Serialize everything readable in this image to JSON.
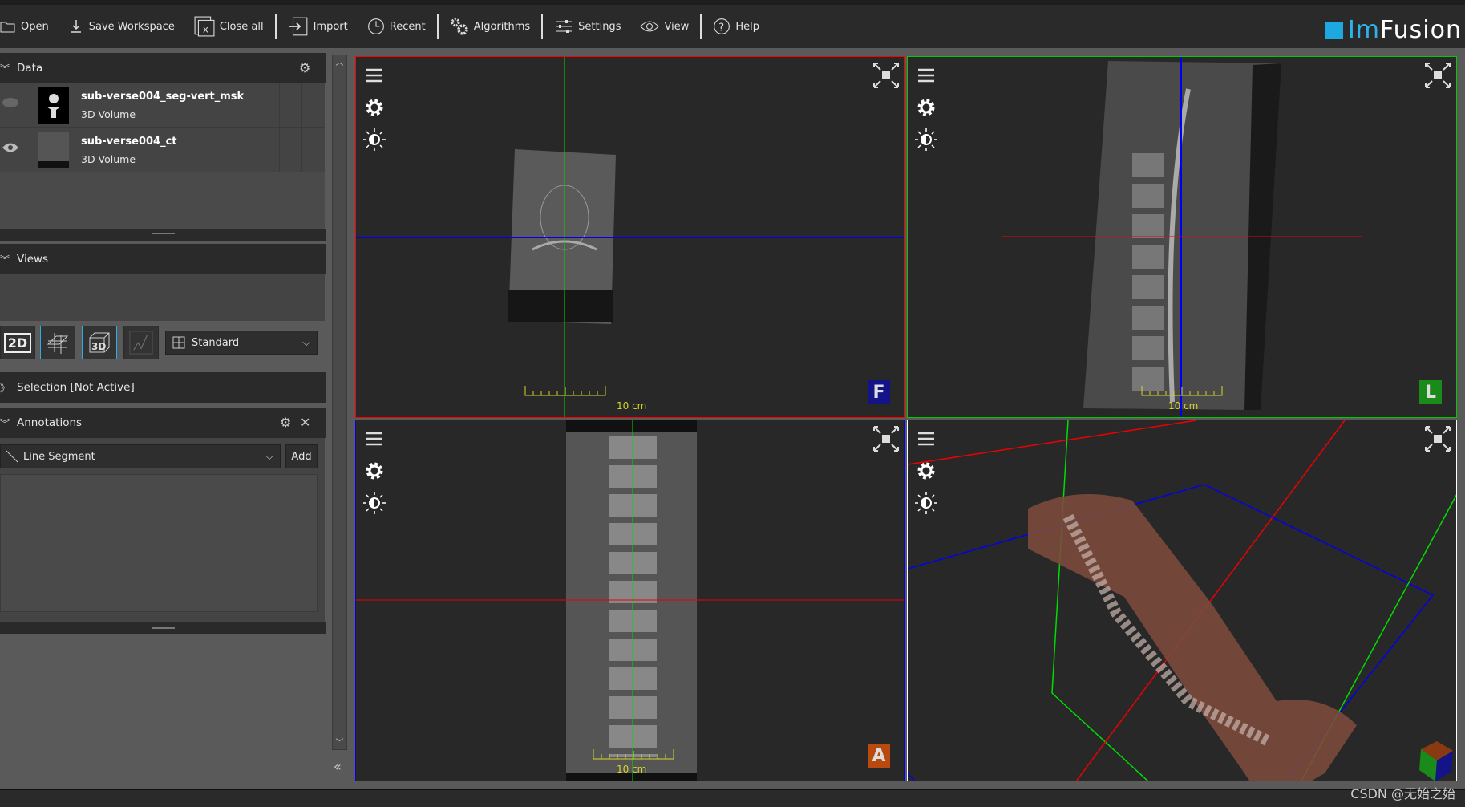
{
  "toolbar": {
    "items": [
      {
        "label": "Open",
        "icon": "folder-icon"
      },
      {
        "label": "Save Workspace",
        "icon": "download-icon"
      },
      {
        "label": "Close all",
        "icon": "close-all-icon"
      },
      {
        "label": "Import",
        "icon": "import-icon"
      },
      {
        "label": "Recent",
        "icon": "clock-icon"
      },
      {
        "label": "Algorithms",
        "icon": "gears-icon"
      },
      {
        "label": "Settings",
        "icon": "sliders-icon"
      },
      {
        "label": "View",
        "icon": "eye-icon"
      },
      {
        "label": "Help",
        "icon": "help-icon"
      }
    ],
    "logo": "ImFusion"
  },
  "data_panel": {
    "title": "Data",
    "items": [
      {
        "name": "sub-verse004_seg-vert_msk",
        "type": "3D Volume",
        "visible": false
      },
      {
        "name": "sub-verse004_ct",
        "type": "3D Volume",
        "visible": true
      }
    ]
  },
  "views_panel": {
    "title": "Views",
    "buttons": [
      "2D",
      "MPR",
      "3D",
      "Plot"
    ],
    "active": [
      "MPR",
      "3D"
    ],
    "layout": "Standard"
  },
  "selection_panel": {
    "title": "Selection [Not Active]"
  },
  "annotations_panel": {
    "title": "Annotations",
    "tool": "Line Segment",
    "add": "Add"
  },
  "viewports": [
    {
      "name": "axial",
      "scale": "10 cm",
      "orientation": "F",
      "border": "#ff0000",
      "badge_color": "#141488"
    },
    {
      "name": "sagittal",
      "scale": "10 cm",
      "orientation": "L",
      "border": "#00cc00",
      "badge_color": "#1a8a1a"
    },
    {
      "name": "coronal",
      "scale": "10 cm",
      "orientation": "A",
      "border": "#0000ff",
      "badge_color": "#b84a10"
    },
    {
      "name": "3d",
      "border": "#ffffff",
      "cube_labels": [
        "P",
        "L",
        "F"
      ]
    }
  ],
  "watermark": "CSDN @无始之始"
}
